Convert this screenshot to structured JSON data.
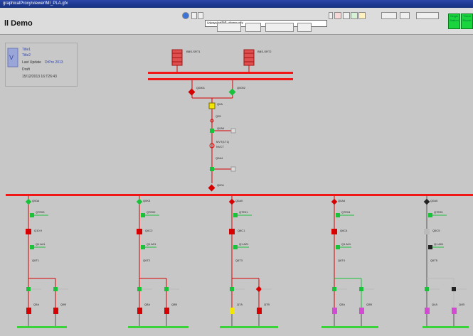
{
  "window": {
    "title": "graphicalProxy\\viewer\\MI_PLA.gfx"
  },
  "app": {
    "title": "ll Demo"
  },
  "toolbar": {
    "path": "/views/sd/MI_demo.gfx",
    "green_buttons": [
      "Single Station",
      "Trend Report"
    ]
  },
  "info_panel": {
    "line1": "Title1",
    "line2": "Title2",
    "line3": "Last Update",
    "line3_value": "DrPro 2013",
    "line4": "Draft",
    "line5": "15/12/2013 16:T26:43"
  },
  "substation": {
    "transformers": [
      "BBS-SRT1",
      "BBS-SRT2"
    ],
    "top_breakers": [
      "Q0001",
      "Q0002"
    ],
    "feeder_labels": [
      "Q0A",
      "Q05",
      "Q0A0",
      "MVT(1T1)",
      "NVCT",
      "Q0A4",
      "Q004"
    ],
    "bays": [
      {
        "name": "Q00A",
        "labels": [
          "Q7E03",
          "Q10.9",
          "Q1 A41",
          "Q6T1",
          "Q9A",
          "Q9B"
        ]
      },
      {
        "name": "Q0K3",
        "labels": [
          "Q7E02",
          "Q6C2",
          "Q1 A31",
          "Q6T2",
          "Q8A",
          "Q8B"
        ]
      },
      {
        "name": "Q0A0",
        "labels": [
          "Q7E01",
          "Q6C1",
          "Q1 A21",
          "Q6T3",
          "Q7A",
          "Q7B"
        ]
      },
      {
        "name": "Q0A4",
        "labels": [
          "Q7E04",
          "Q6C4",
          "Q1 A11",
          "Q6T4",
          "Q5A",
          "Q5B"
        ]
      },
      {
        "name": "Q0A5",
        "labels": [
          "Q7E05",
          "Q6C5",
          "Q1 A01",
          "Q6T5",
          "Q4A",
          "Q4B"
        ]
      }
    ]
  },
  "colors": {
    "busbar": "#f21717",
    "closed": "#d60000",
    "open": "#19c23a",
    "warn": "#f3e600",
    "ground": "#3ad43a",
    "magenta": "#d24bd2"
  }
}
